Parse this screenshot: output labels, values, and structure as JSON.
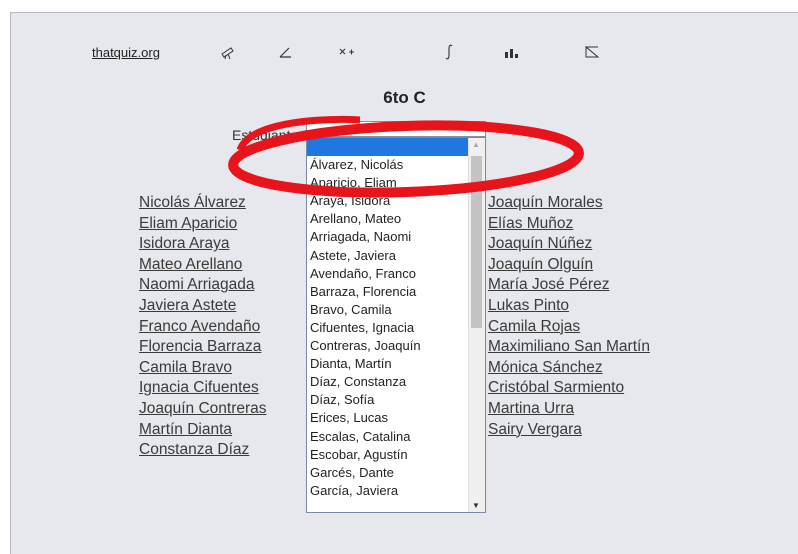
{
  "nav": {
    "logo": "thatquiz.org",
    "icons": [
      "telescope-icon",
      "angle-icon",
      "operations-icon",
      "integral-icon",
      "bar-chart-icon",
      "geometry-icon"
    ]
  },
  "page": {
    "title": "6to C"
  },
  "form": {
    "label": "Estudiante",
    "selected_value": ""
  },
  "students_left": [
    "Nicolás Álvarez",
    "Eliam Aparicio",
    "Isidora Araya",
    "Mateo Arellano",
    "Naomi Arriagada",
    "Javiera Astete",
    "Franco Avendaño",
    "Florencia Barraza",
    "Camila Bravo",
    "Ignacia Cifuentes",
    "Joaquín Contreras",
    "Martín Dianta",
    "Constanza Díaz"
  ],
  "students_right": [
    "Joaquín Morales",
    "Elías Muñoz",
    "Joaquín Núñez",
    "Joaquín Olguín",
    "María José Pérez",
    "Lukas Pinto",
    "Camila Rojas",
    "Maximiliano San Martín",
    "Mónica Sánchez",
    "Cristóbal Sarmiento",
    "Martina Urra",
    "Sairy Vergara"
  ],
  "dropdown_options": [
    "",
    "Álvarez, Nicolás",
    "Aparicio, Eliam",
    "Araya, Isidora",
    "Arellano, Mateo",
    "Arriagada, Naomi",
    "Astete, Javiera",
    "Avendaño, Franco",
    "Barraza, Florencia",
    "Bravo, Camila",
    "Cifuentes, Ignacia",
    "Contreras, Joaquín",
    "Dianta, Martín",
    "Díaz, Constanza",
    "Díaz, Sofía",
    "Erices, Lucas",
    "Escalas, Catalina",
    "Escobar, Agustín",
    "Garcés, Dante",
    "García, Javiera"
  ],
  "colors": {
    "panel": "#e6e8ee",
    "highlight": "#1e78e0",
    "annotation": "#e8141b"
  }
}
